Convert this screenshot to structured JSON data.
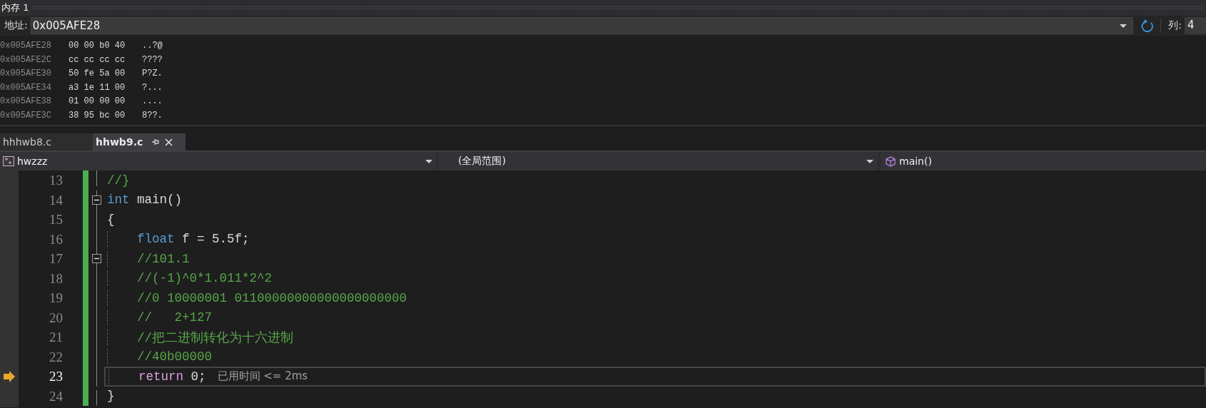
{
  "memory_window": {
    "title": "内存 1",
    "address_label": "地址:",
    "address": "0x005AFE28",
    "columns_label": "列:",
    "columns": "4",
    "rows": [
      {
        "address": "0x005AFE28",
        "bytes": "00 00 b0 40",
        "chars": "..?@"
      },
      {
        "address": "0x005AFE2C",
        "bytes": "cc cc cc cc",
        "chars": "????"
      },
      {
        "address": "0x005AFE30",
        "bytes": "50 fe 5a 00",
        "chars": "P?Z."
      },
      {
        "address": "0x005AFE34",
        "bytes": "a3 1e 11 00",
        "chars": "?..."
      },
      {
        "address": "0x005AFE38",
        "bytes": "01 00 00 00",
        "chars": "...."
      },
      {
        "address": "0x005AFE3C",
        "bytes": "38 95 bc 00",
        "chars": "8??."
      }
    ]
  },
  "tabs": [
    {
      "label": "hhhwb8.c",
      "selected": false
    },
    {
      "label": "hhwb9.c",
      "selected": true
    }
  ],
  "navigation_bar": [
    {
      "kind": "project",
      "label": "hwzzz"
    },
    {
      "kind": "scope",
      "label": "(全局范围)"
    },
    {
      "kind": "function",
      "label": "main()"
    }
  ],
  "editor": {
    "lines": [
      {
        "number": "13",
        "current": false,
        "tokens": [
          {
            "kind": "comment",
            "text": "//}"
          }
        ]
      },
      {
        "number": "14",
        "current": false,
        "expanded": true,
        "tokens": [
          {
            "kind": "keyword",
            "text": "int"
          },
          {
            "kind": "plain",
            "text": " main()"
          }
        ]
      },
      {
        "number": "15",
        "current": false,
        "tokens": [
          {
            "kind": "plain",
            "text": "{"
          }
        ]
      },
      {
        "number": "16",
        "current": false,
        "indented": true,
        "tokens": [
          {
            "kind": "keyword",
            "text": "float"
          },
          {
            "kind": "plain",
            "text": " f = 5.5f;"
          }
        ]
      },
      {
        "number": "17",
        "current": false,
        "indented": true,
        "expanded": true,
        "tokens": [
          {
            "kind": "comment",
            "text": "//101.1"
          }
        ]
      },
      {
        "number": "18",
        "current": false,
        "indented": true,
        "tokens": [
          {
            "kind": "comment",
            "text": "//(-1)^0*1.011*2^2"
          }
        ]
      },
      {
        "number": "19",
        "current": false,
        "indented": true,
        "tokens": [
          {
            "kind": "comment",
            "text": "//0 10000001 01100000000000000000000"
          }
        ]
      },
      {
        "number": "20",
        "current": false,
        "indented": true,
        "tokens": [
          {
            "kind": "comment",
            "text": "//   2+127"
          }
        ]
      },
      {
        "number": "21",
        "current": false,
        "indented": true,
        "tokens": [
          {
            "kind": "comment",
            "text": "//把二进制转化为十六进制"
          }
        ]
      },
      {
        "number": "22",
        "current": false,
        "indented": true,
        "tokens": [
          {
            "kind": "comment",
            "text": "//40b00000"
          }
        ]
      },
      {
        "number": "23",
        "current": true,
        "indented": true,
        "tokens": [
          {
            "kind": "control",
            "text": "return"
          },
          {
            "kind": "plain",
            "text": " 0;"
          }
        ],
        "hint": "已用时间 <= 2ms"
      },
      {
        "number": "24",
        "current": false,
        "tokens": [
          {
            "kind": "plain",
            "text": "}"
          }
        ]
      }
    ]
  }
}
